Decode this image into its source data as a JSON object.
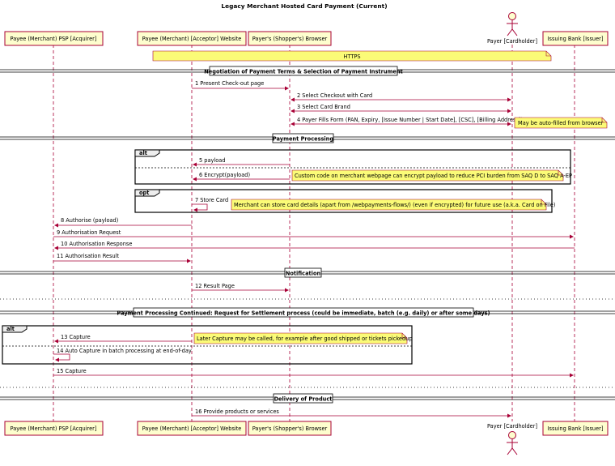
{
  "diagram": {
    "title": "Legacy Merchant Hosted Card Payment (Current)",
    "participants": {
      "psp": "Payee (Merchant) PSP [Acquirer]",
      "website": "Payee (Merchant) [Acceptor] Website",
      "browser": "Payer's (Shopper's) Browser",
      "cardholder": "Payer [Cardholder]",
      "bank": "Issuing Bank [Issuer]"
    },
    "https_note": "HTTPS",
    "sections": {
      "negotiation": "Negotiation of Payment Terms & Selection of Payment Instrument",
      "processing": "Payment Processing",
      "notification": "Notification",
      "settlement": "Payment Processing Continued: Request for Settlement process (could be immediate, batch (e.g. daily) or after some days)",
      "delivery": "Delivery of Product"
    },
    "fragments": {
      "alt1": "alt",
      "opt": "opt",
      "alt2": "alt"
    },
    "messages": {
      "m1": "1 Present Check-out page",
      "m2": "2 Select Checkout with Card",
      "m3": "3 Select Card Brand",
      "m4": "4 Payer Fills Form (PAN, Expiry, [Issue Number | Start Date], [CSC], [Billing Address])",
      "m5": "5 payload",
      "m6": "6 Encrypt(payload)",
      "m7": "7 Store Card",
      "m8": "8 Authorise (payload)",
      "m9": "9 Authorisation Request",
      "m10": "10 Authorisation Response",
      "m11": "11 Authorisation Result",
      "m12": "12 Result Page",
      "m13": "13 Capture",
      "m14": "14 Auto Capture in batch processing at end-of-day",
      "m15": "15 Capture",
      "m16": "16 Provide products or services"
    },
    "notes": {
      "autofill": "May be auto-filled from browser",
      "encrypt": "Custom code on merchant webpage can encrypt payload to reduce PCI burden from SAQ D to SAQ A-EP",
      "store": "Merchant can store card details (apart from /webpayments-flows/) (even if encrypted) for future use (a.k.a. Card on File)",
      "capture": "Later Capture may be called, for example after good shipped or tickets pickedup"
    },
    "colors": {
      "participant_fill": "#FEFECE",
      "line": "#A80036",
      "note_fill": "#FBFB77"
    }
  }
}
